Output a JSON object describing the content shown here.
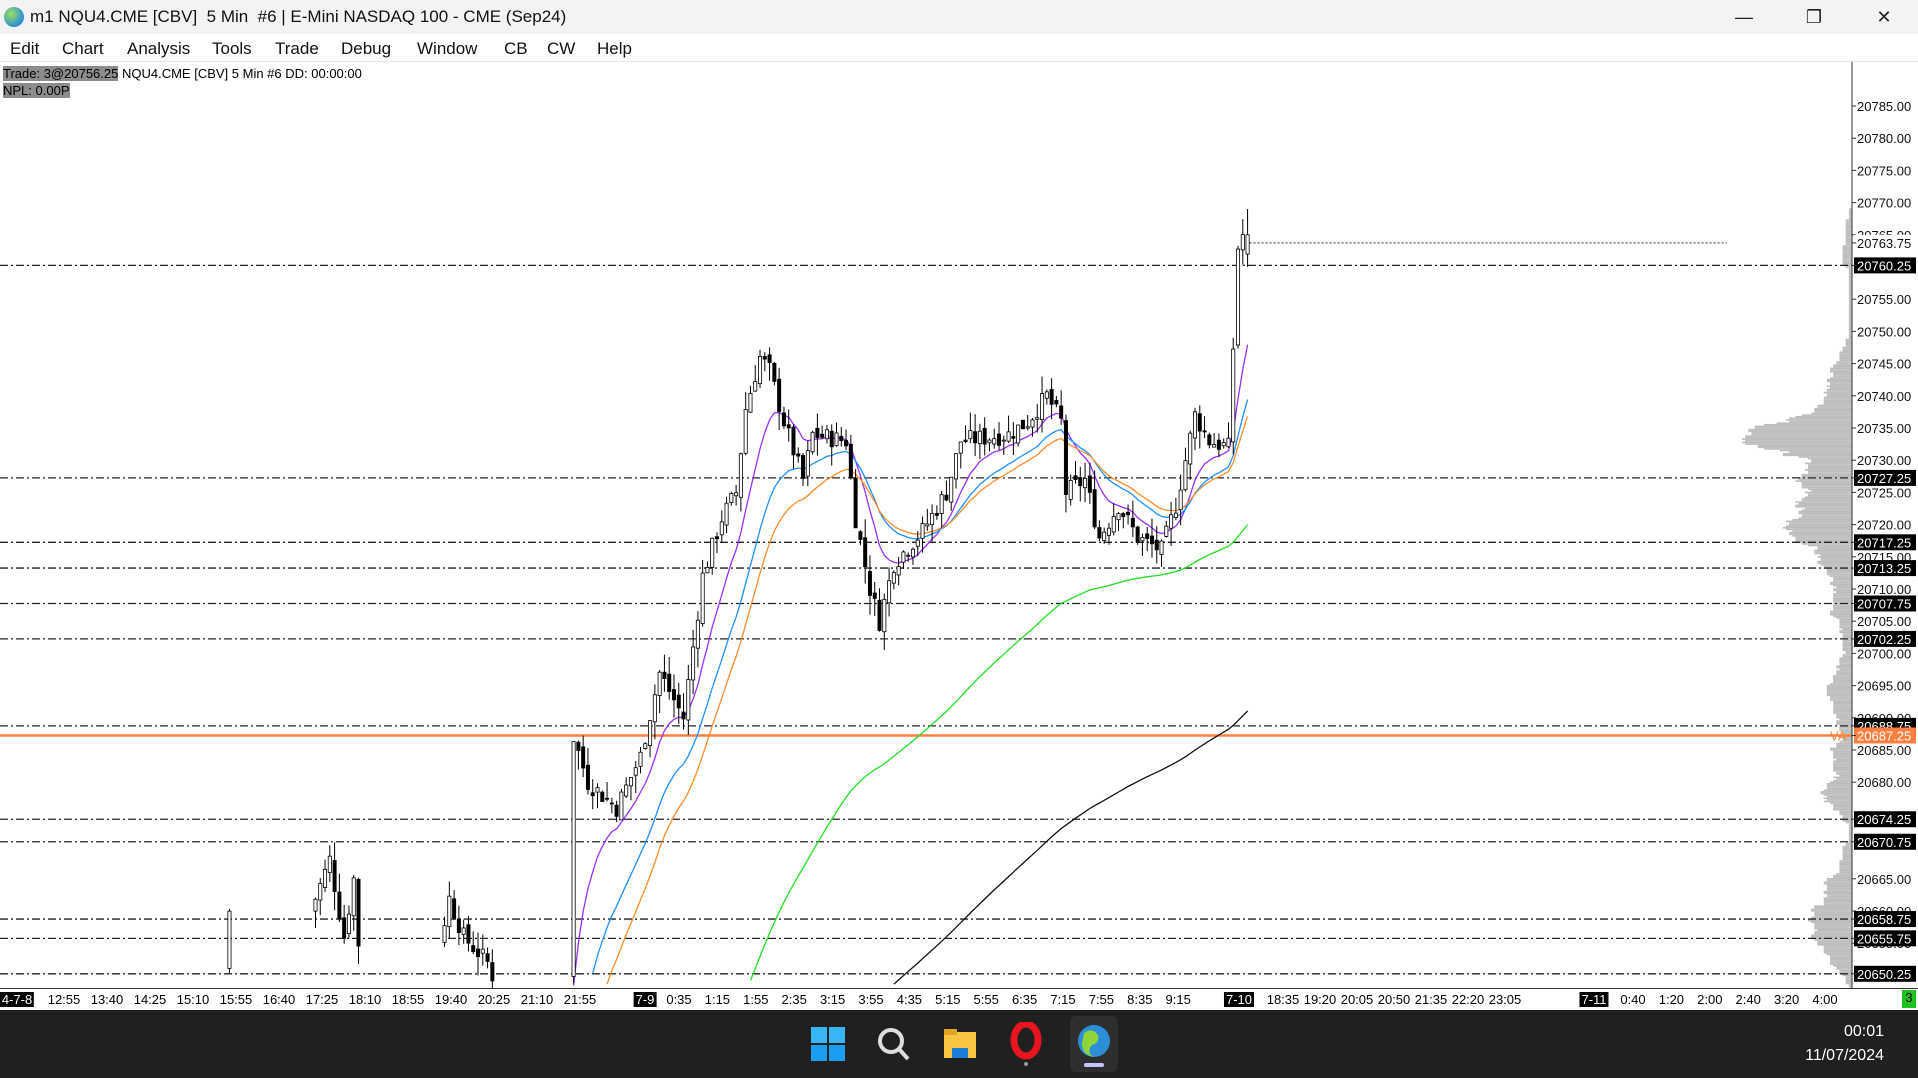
{
  "window": {
    "title": "m1 NQU4.CME [CBV]  5 Min  #6 | E-Mini NASDAQ 100 - CME (Sep24)",
    "minimize": "—",
    "restore": "❐",
    "close": "✕"
  },
  "menu": [
    "Edit",
    "Chart",
    "Analysis",
    "Tools",
    "Trade",
    "Debug",
    "Window",
    "CB",
    "CW",
    "Help"
  ],
  "info": {
    "trade": "Trade: 3@20756.25",
    "symbol": "NQU4.CME [CBV]  5 Min  #6 DD: 00:00:00",
    "npl": "NPL: 0.00P"
  },
  "chart_data": {
    "type": "candlestick",
    "ylim": [
      20648,
      20789
    ],
    "price_ticks": [
      "20785.00",
      "20780.00",
      "20775.00",
      "20770.00",
      "20765.00",
      "20755.00",
      "20750.00",
      "20745.00",
      "20740.00",
      "20735.00",
      "20730.00",
      "20725.00",
      "20720.00",
      "20715.00",
      "20710.00",
      "20705.00",
      "20700.00",
      "20695.00",
      "20690.00",
      "20685.00",
      "20680.00",
      "20665.00",
      "20660.00",
      "20655.00"
    ],
    "levels": [
      "20760.25",
      "20727.25",
      "20717.25",
      "20713.25",
      "20707.75",
      "20702.25",
      "20688.75",
      "20674.25",
      "20670.75",
      "20658.75",
      "20655.75",
      "20650.25"
    ],
    "last_price": {
      "value": "20763.75"
    },
    "value_area": {
      "label": "VA",
      "value": "20687.25",
      "color": "#ff7f3f"
    },
    "price_path": [
      [
        48,
        20651
      ],
      [
        66,
        20660
      ],
      [
        70,
        20668
      ],
      [
        73,
        20656
      ],
      [
        75,
        20665
      ],
      [
        93,
        20655
      ],
      [
        95,
        20662
      ],
      [
        98,
        20656
      ],
      [
        103,
        20652
      ],
      [
        120,
        20650
      ],
      [
        121,
        20687
      ],
      [
        124,
        20680
      ],
      [
        130,
        20676
      ],
      [
        135,
        20684
      ],
      [
        139,
        20697
      ],
      [
        144,
        20690
      ],
      [
        148,
        20712
      ],
      [
        152,
        20721
      ],
      [
        155,
        20725
      ],
      [
        157,
        20738
      ],
      [
        160,
        20746
      ],
      [
        162,
        20744
      ],
      [
        165,
        20736
      ],
      [
        169,
        20727
      ],
      [
        171,
        20734
      ],
      [
        178,
        20733
      ],
      [
        180,
        20721
      ],
      [
        183,
        20710
      ],
      [
        185,
        20705
      ],
      [
        188,
        20714
      ],
      [
        194,
        20719
      ],
      [
        199,
        20725
      ],
      [
        202,
        20733
      ],
      [
        212,
        20734
      ],
      [
        216,
        20736
      ],
      [
        220,
        20740
      ],
      [
        223,
        20736
      ],
      [
        224,
        20725
      ],
      [
        228,
        20727
      ],
      [
        231,
        20718
      ],
      [
        235,
        20723
      ],
      [
        239,
        20718
      ],
      [
        244,
        20716
      ],
      [
        247,
        20723
      ],
      [
        251,
        20737
      ],
      [
        254,
        20733
      ],
      [
        258,
        20732
      ],
      [
        260,
        20763
      ],
      [
        261,
        20765
      ]
    ],
    "moving_averages": [
      {
        "period": 10,
        "color": "#9b30ff"
      },
      {
        "period": 20,
        "color": "#1e90ff"
      },
      {
        "period": 26,
        "color": "#ff8c2a"
      },
      {
        "period": 100,
        "color": "#22e022"
      },
      {
        "period": 200,
        "color": "#111111"
      }
    ],
    "time_labels": {
      "d1": "4-7-8",
      "s1": [
        "12:55",
        "13:40",
        "14:25",
        "15:10",
        "15:55",
        "16:40",
        "17:25",
        "18:10",
        "18:55",
        "19:40",
        "20:25",
        "21:10",
        "21:55"
      ],
      "d2": "7-9",
      "s2": [
        "0:35",
        "1:15",
        "1:55",
        "2:35",
        "3:15",
        "3:55",
        "4:35",
        "5:15",
        "5:55",
        "6:35",
        "7:15",
        "7:55",
        "8:35",
        "9:15"
      ],
      "d3": "7-10",
      "s3": [
        "18:35",
        "19:20",
        "20:05",
        "20:50",
        "21:35",
        "22:20",
        "23:05"
      ],
      "d4": "7-11",
      "s4": [
        "0:40",
        "1:20",
        "2:00",
        "2:40",
        "3:20",
        "4:00"
      ]
    }
  },
  "status": {
    "count": "3"
  },
  "taskbar": {
    "time": "00:01",
    "date": "11/07/2024",
    "apps": [
      "start-icon",
      "search-icon",
      "file-explorer-icon",
      "opera-icon",
      "chart-app-icon"
    ]
  }
}
